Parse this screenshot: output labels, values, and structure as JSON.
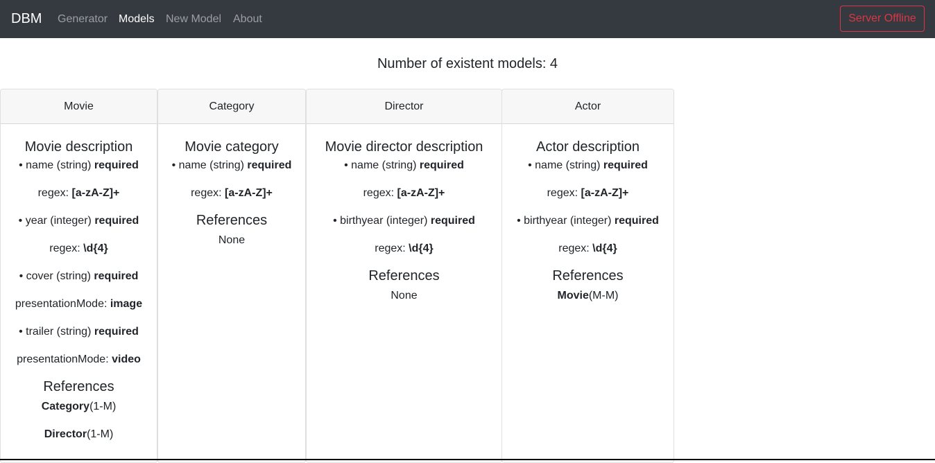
{
  "navbar": {
    "brand": "DBM",
    "links": [
      {
        "label": "Generator",
        "active": false
      },
      {
        "label": "Models",
        "active": true
      },
      {
        "label": "New Model",
        "active": false
      },
      {
        "label": "About",
        "active": false
      }
    ],
    "server_status": "Server Offline"
  },
  "main": {
    "count_label": "Number of existent models: 4"
  },
  "models": [
    {
      "name": "Movie",
      "description": "Movie description",
      "attributes": [
        {
          "name": "name",
          "type": "string",
          "required": "required",
          "extra_key": "regex:",
          "extra_value": "[a-zA-Z]+"
        },
        {
          "name": "year",
          "type": "integer",
          "required": "required",
          "extra_key": "regex:",
          "extra_value": "\\d{4}"
        },
        {
          "name": "cover",
          "type": "string",
          "required": "required",
          "extra_key": "presentationMode:",
          "extra_value": "image"
        },
        {
          "name": "trailer",
          "type": "string",
          "required": "required",
          "extra_key": "presentationMode:",
          "extra_value": "video"
        }
      ],
      "references_title": "References",
      "references": [
        {
          "model": "Category",
          "relation": "(1-M)"
        },
        {
          "model": "Director",
          "relation": "(1-M)"
        }
      ],
      "references_none": ""
    },
    {
      "name": "Category",
      "description": "Movie category",
      "attributes": [
        {
          "name": "name",
          "type": "string",
          "required": "required",
          "extra_key": "regex:",
          "extra_value": "[a-zA-Z]+"
        }
      ],
      "references_title": "References",
      "references": [],
      "references_none": "None"
    },
    {
      "name": "Director",
      "description": "Movie director description",
      "attributes": [
        {
          "name": "name",
          "type": "string",
          "required": "required",
          "extra_key": "regex:",
          "extra_value": "[a-zA-Z]+"
        },
        {
          "name": "birthyear",
          "type": "integer",
          "required": "required",
          "extra_key": "regex:",
          "extra_value": "\\d{4}"
        }
      ],
      "references_title": "References",
      "references": [],
      "references_none": "None"
    },
    {
      "name": "Actor",
      "description": "Actor description",
      "attributes": [
        {
          "name": "name",
          "type": "string",
          "required": "required",
          "extra_key": "regex:",
          "extra_value": "[a-zA-Z]+"
        },
        {
          "name": "birthyear",
          "type": "integer",
          "required": "required",
          "extra_key": "regex:",
          "extra_value": "\\d{4}"
        }
      ],
      "references_title": "References",
      "references": [
        {
          "model": "Movie",
          "relation": "(M-M)"
        }
      ],
      "references_none": ""
    }
  ],
  "colors": {
    "navbar_bg": "#343a40",
    "danger": "#dc3545",
    "card_header_bg": "#f7f7f7"
  }
}
